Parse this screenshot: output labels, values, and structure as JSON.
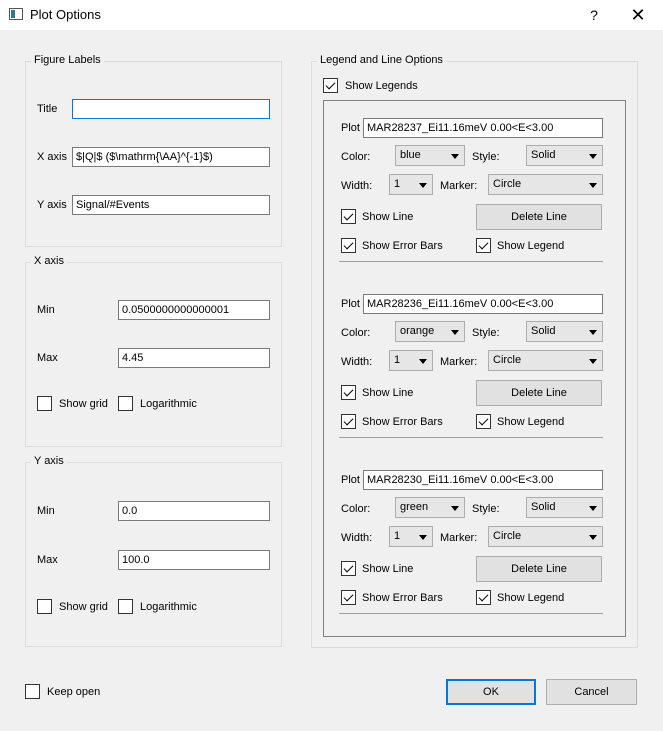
{
  "window": {
    "title": "Plot Options",
    "help_label": "?",
    "close_label": "✕"
  },
  "figure_labels": {
    "group_title": "Figure Labels",
    "title_label": "Title",
    "title_value": "",
    "xaxis_label": "X axis",
    "xaxis_value": "$|Q|$ ($\\mathrm{\\AA}^{-1}$)",
    "yaxis_label": "Y axis",
    "yaxis_value": "Signal/#Events"
  },
  "x_axis": {
    "group_title": "X axis",
    "min_label": "Min",
    "min_value": "0.0500000000000001",
    "max_label": "Max",
    "max_value": "4.45",
    "grid_label": "Show grid",
    "grid_checked": false,
    "log_label": "Logarithmic",
    "log_checked": false
  },
  "y_axis": {
    "group_title": "Y axis",
    "min_label": "Min",
    "min_value": "0.0",
    "max_label": "Max",
    "max_value": "100.0",
    "grid_label": "Show grid",
    "grid_checked": false,
    "log_label": "Logarithmic",
    "log_checked": false
  },
  "legend": {
    "group_title": "Legend and Line Options",
    "show_legends_label": "Show Legends",
    "show_legends_checked": true,
    "plot_label": "Plot",
    "color_label": "Color:",
    "style_label": "Style:",
    "width_label": "Width:",
    "marker_label": "Marker:",
    "show_line_label": "Show Line",
    "delete_line_label": "Delete Line",
    "show_error_bars_label": "Show Error Bars",
    "show_legend_label": "Show Legend",
    "lines": [
      {
        "name": "MAR28237_Ei11.16meV 0.00<E<3.00",
        "color": "blue",
        "style": "Solid",
        "width": "1",
        "marker": "Circle",
        "show_line": true,
        "show_error_bars": true,
        "show_legend": true
      },
      {
        "name": "MAR28236_Ei11.16meV 0.00<E<3.00",
        "color": "orange",
        "style": "Solid",
        "width": "1",
        "marker": "Circle",
        "show_line": true,
        "show_error_bars": true,
        "show_legend": true
      },
      {
        "name": "MAR28230_Ei11.16meV 0.00<E<3.00",
        "color": "green",
        "style": "Solid",
        "width": "1",
        "marker": "Circle",
        "show_line": true,
        "show_error_bars": true,
        "show_legend": true
      }
    ]
  },
  "footer": {
    "keep_open_label": "Keep open",
    "keep_open_checked": false,
    "ok_label": "OK",
    "cancel_label": "Cancel"
  }
}
